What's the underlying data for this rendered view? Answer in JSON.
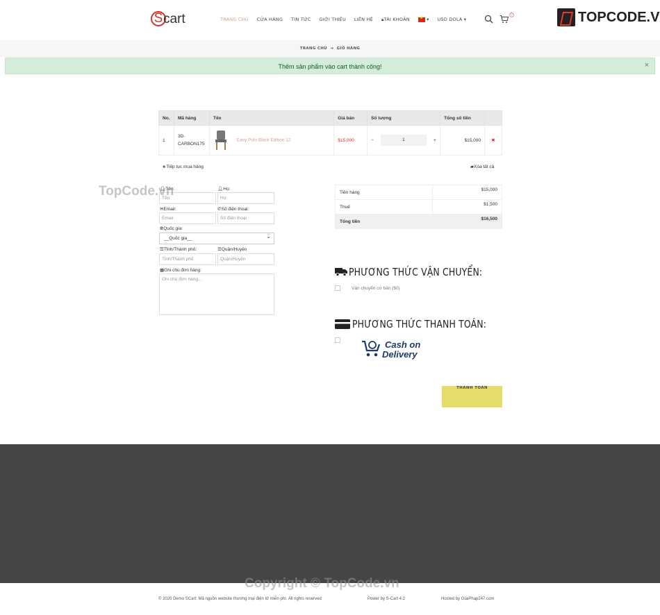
{
  "header": {
    "logo_s": "S",
    "logo_rest": "cart",
    "nav": [
      "TRANG CHỦ",
      "CỬA HÀNG",
      "TIN TỨC",
      "GIỚI THIỆU",
      "LIÊN HỆ",
      "TÀI KHOẢN",
      "USD DOLA"
    ],
    "cart_count": "0",
    "brand_a": "TOP",
    "brand_b": "CODE.VN"
  },
  "breadcrumb": {
    "home": "TRANG CHỦ",
    "current": "GIỎ HÀNG"
  },
  "alert": {
    "message": "Thêm sản phẩm vào cart thành công!",
    "close": "×"
  },
  "cart_table": {
    "headers": [
      "No.",
      "Mã hàng",
      "Tên",
      "Giá bán",
      "Số lượng",
      "Tổng số tiền"
    ],
    "rows": [
      {
        "no": "1",
        "sku": "3D-CARBON175",
        "name": "Easy Polo Black Edition 12",
        "price": "$15,000",
        "qty": "1",
        "total": "$15,000"
      }
    ]
  },
  "links": {
    "continue": "Tiếp tục mua hàng",
    "clear": "Xóa tất cả"
  },
  "form": {
    "first_name_label": "Tên:",
    "first_name_ph": "Tên",
    "last_name_label": "Họ:",
    "last_name_ph": "Họ",
    "email_label": "Email:",
    "email_ph": "Email",
    "phone_label": "Số điện thoại:",
    "phone_ph": "Số điện thoại",
    "country_label": "Quốc gia:",
    "country_value": "__Quốc gia__",
    "province_label": "Tỉnh/Thành phố:",
    "province_ph": "Tỉnh/Thành phố",
    "district_label": "Quận/Huyện",
    "district_ph": "Quận/Huyện",
    "note_label": "Ghi chú đơn hàng:",
    "note_ph": "Ghi chú đơn hàng..."
  },
  "totals": [
    {
      "label": "Tiền hàng",
      "value": "$15,000"
    },
    {
      "label": "Thuế",
      "value": "$1,500"
    },
    {
      "label": "Tổng tiền",
      "value": "$16,500"
    }
  ],
  "shipping": {
    "title": "PHƯƠNG THỨC VẬN CHUYỂN:",
    "option": "Vận chuyển cơ bản ($0)"
  },
  "payment": {
    "title": "PHƯƠNG THỨC THANH TOÁN:",
    "cod_line1": "Cash on",
    "cod_line2": "Delivery"
  },
  "checkout_button": "THANH TOÁN",
  "footer": {
    "copyright": "© 2020 Demo SCart: Mã nguồn website thương mại điện tử miễn phí. All rights reserved",
    "powered": "Power by S-Cart 4.2",
    "hosted": "Hosted by GiaiPhap247.com"
  },
  "watermarks": {
    "left": "TopCode.vn",
    "bottom": "Copyright © TopCode.vn"
  }
}
